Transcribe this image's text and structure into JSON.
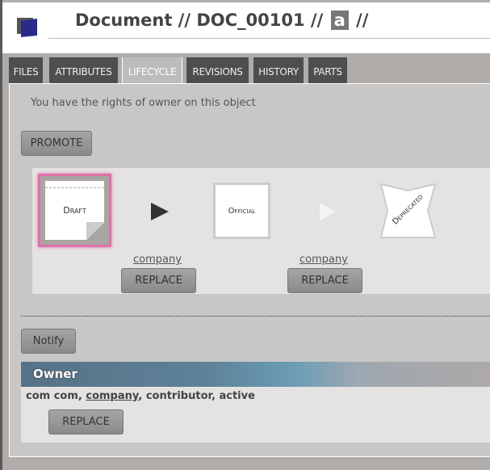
{
  "header": {
    "title_prefix": "Document // DOC_00101 //",
    "revision": "a",
    "title_suffix": "//"
  },
  "tabs": [
    {
      "label": "FILES"
    },
    {
      "label": "ATTRIBUTES"
    },
    {
      "label": "LIFECYCLE",
      "active": true
    },
    {
      "label": "REVISIONS"
    },
    {
      "label": "HISTORY"
    },
    {
      "label": "PARTS"
    }
  ],
  "lifecycle": {
    "rights_text": "You have the rights of owner on this object",
    "promote_label": "PROMOTE",
    "states": [
      {
        "label": "Draft",
        "current": true
      },
      {
        "label": "Official"
      },
      {
        "label": "Deprecated"
      }
    ],
    "signers": [
      {
        "link": "company",
        "button": "REPLACE"
      },
      {
        "link": "company",
        "button": "REPLACE"
      }
    ],
    "notify_label": "Notify"
  },
  "owner": {
    "heading": "Owner",
    "name": "com com",
    "company": "company",
    "role": "contributor",
    "status": "active",
    "replace_label": "REPLACE"
  },
  "colors": {
    "current_state_glow": "#e070a8",
    "tab_dark": "#4e4e4e"
  }
}
